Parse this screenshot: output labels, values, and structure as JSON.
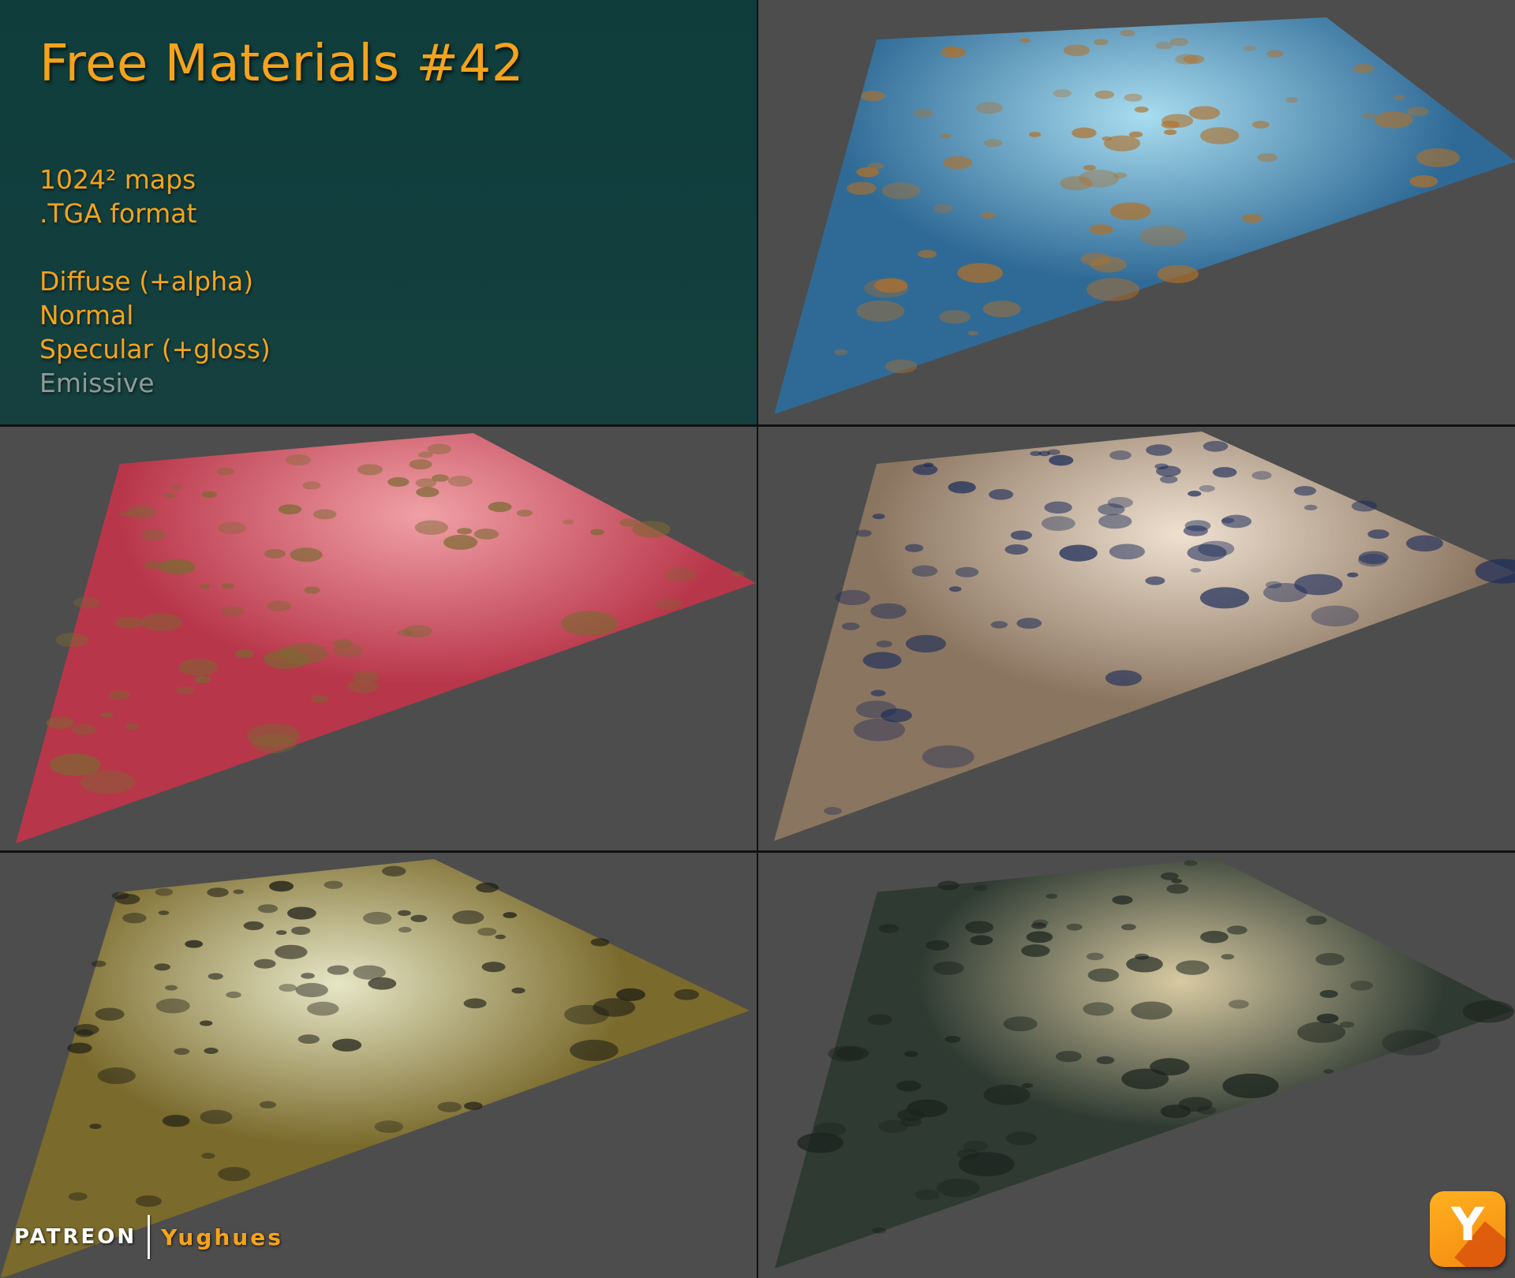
{
  "title": "Free Materials #42",
  "specs": {
    "resolution": "1024² maps",
    "format": ".TGA format",
    "maps": [
      "Diffuse (+alpha)",
      "Normal",
      "Specular (+gloss)"
    ],
    "disabled_map": "Emissive"
  },
  "branding": {
    "platform": "PATREON",
    "author": "Yughues",
    "logo_glyph": "Y"
  },
  "materials": [
    {
      "name": "blue-rusty-metal",
      "base": "#2f6a96",
      "highlight": "#a8dcef",
      "spots": "#b0702a"
    },
    {
      "name": "red-painted-metal",
      "base": "#b8364a",
      "highlight": "#f0a0a6",
      "spots": "#7a6a32"
    },
    {
      "name": "beige-worn-metal",
      "base": "#8a7560",
      "highlight": "#efe0d0",
      "spots": "#1c2c5a"
    },
    {
      "name": "green-rusty-metal",
      "base": "#7a6a2c",
      "highlight": "#e6e6c6",
      "spots": "#1a1a14"
    },
    {
      "name": "dark-scratched-metal",
      "base": "#2e3a32",
      "highlight": "#d8caa2",
      "spots": "#1a221c"
    }
  ],
  "colors": {
    "accent": "#f5a31a",
    "panel_bg": "#0f3d3c",
    "tile_bg": "#4d4d4d",
    "disabled_text": "#8e9a99"
  }
}
